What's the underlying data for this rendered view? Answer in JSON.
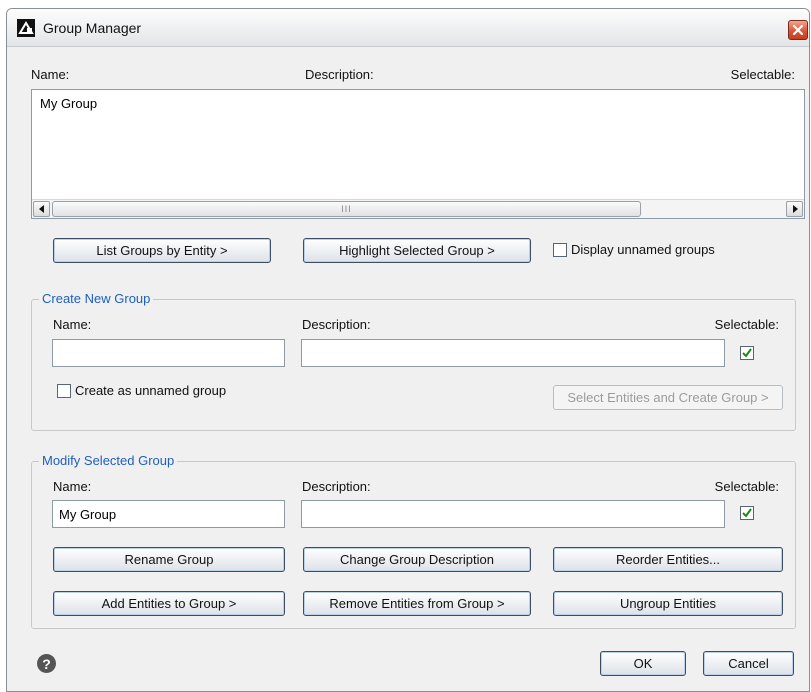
{
  "window": {
    "title": "Group Manager",
    "close_icon": "close-icon",
    "app_icon": "autocad-group-icon"
  },
  "groups_list": {
    "col_name": "Name:",
    "col_description": "Description:",
    "col_selectable": "Selectable:",
    "items": [
      "My Group"
    ],
    "scroll_grip": "III"
  },
  "list_actions": {
    "list_by_entity": "List Groups by Entity >",
    "highlight_selected": "Highlight Selected Group >",
    "display_unnamed": "Display unnamed groups",
    "display_unnamed_checked": false
  },
  "create_group": {
    "title": "Create New Group",
    "name_label": "Name:",
    "description_label": "Description:",
    "selectable_label": "Selectable:",
    "name_value": "",
    "description_value": "",
    "selectable_checked": true,
    "unnamed_label": "Create as unnamed group",
    "unnamed_checked": false,
    "create_button": "Select Entities and Create Group >"
  },
  "modify_group": {
    "title": "Modify Selected Group",
    "name_label": "Name:",
    "description_label": "Description:",
    "selectable_label": "Selectable:",
    "name_value": "My Group",
    "description_value": "",
    "selectable_checked": true,
    "rename": "Rename Group",
    "change_description": "Change Group Description",
    "reorder": "Reorder Entities...",
    "add_entities": "Add Entities to Group >",
    "remove_entities": "Remove Entities from Group >",
    "ungroup": "Ungroup Entities"
  },
  "footer": {
    "help_icon": "help-icon",
    "help_glyph": "?",
    "ok": "OK",
    "cancel": "Cancel"
  },
  "colors": {
    "group_title": "#1f5fbf",
    "check_mark": "#1a8a1a",
    "close_button": "#d9573a"
  }
}
